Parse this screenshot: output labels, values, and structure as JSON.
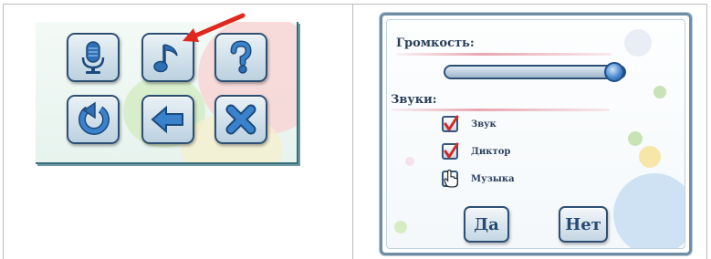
{
  "left_panel": {
    "buttons": [
      {
        "icon": "microphone-icon"
      },
      {
        "icon": "music-note-icon"
      },
      {
        "icon": "question-icon"
      },
      {
        "icon": "refresh-icon"
      },
      {
        "icon": "back-arrow-icon"
      },
      {
        "icon": "close-icon"
      }
    ],
    "annotation": "red-arrow-pointer"
  },
  "dialog": {
    "volume_label": "Громкость:",
    "volume_level": 1.0,
    "sounds_label": "Звуки:",
    "options": [
      {
        "label": "Звук",
        "checked": true
      },
      {
        "label": "Диктор",
        "checked": true
      },
      {
        "label": "Музыка",
        "checked": false
      }
    ],
    "ok_label": "Да",
    "cancel_label": "Нет"
  },
  "colors": {
    "button_border": "#2d4f73",
    "icon_blue": "#2f6fb3",
    "check_red": "#d12a2a",
    "arrow_red": "#e0281e"
  }
}
